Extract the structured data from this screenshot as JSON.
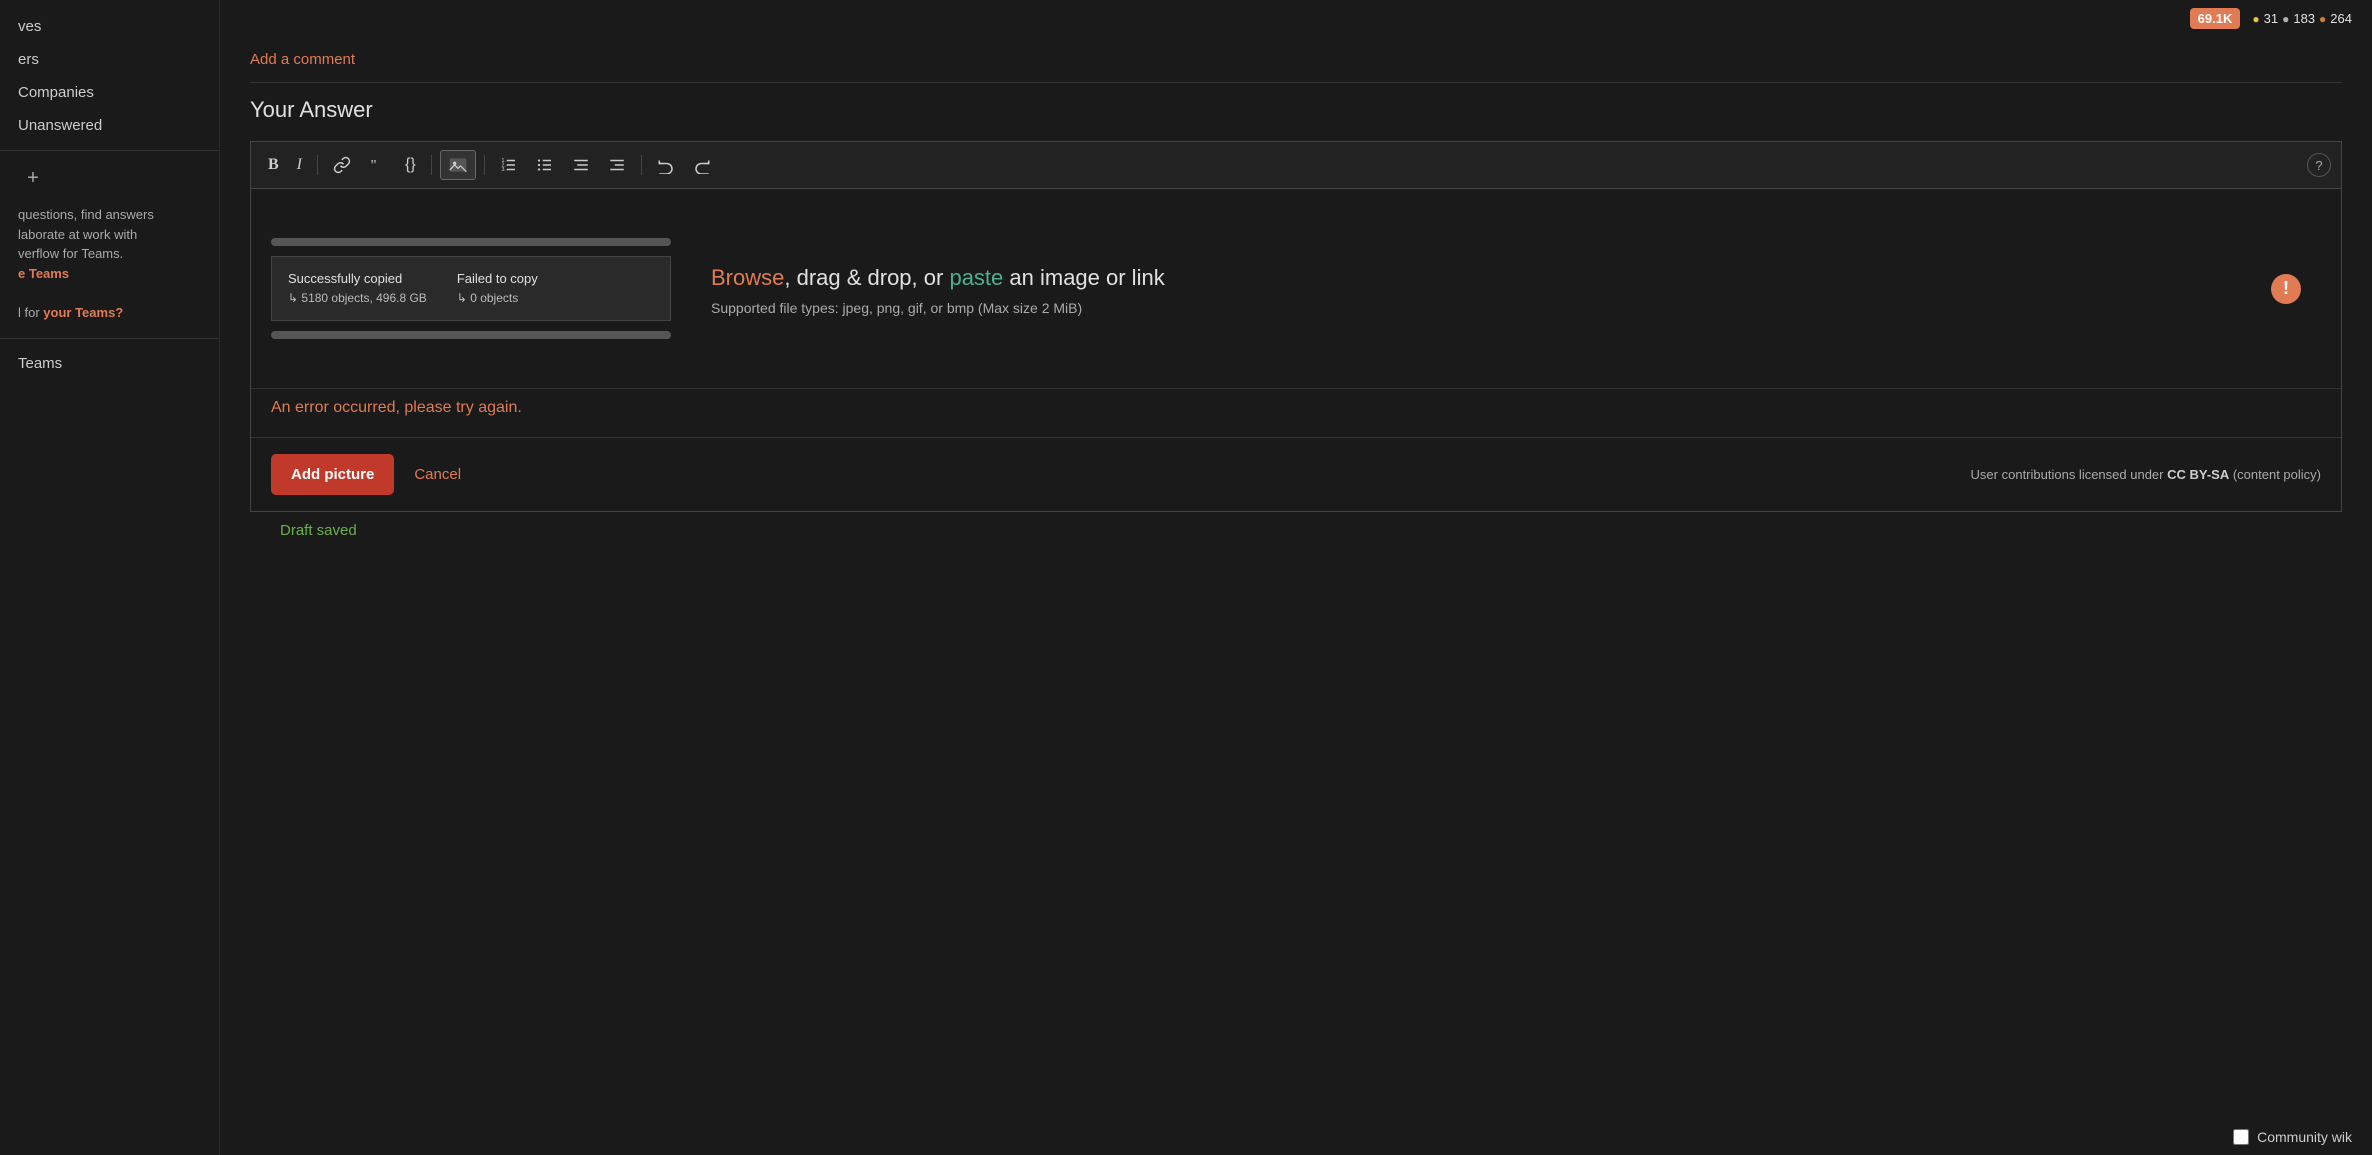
{
  "sidebar": {
    "items": [
      {
        "id": "ves",
        "label": "ves"
      },
      {
        "id": "ers",
        "label": "ers"
      },
      {
        "id": "companies",
        "label": "Companies"
      },
      {
        "id": "unanswered",
        "label": "Unanswered"
      },
      {
        "id": "teams",
        "label": "Teams"
      }
    ],
    "add_button_label": "+",
    "promo_text_1": "questions, find answers",
    "promo_text_2": "laborate at work with",
    "promo_text_3": "verflow for Teams.",
    "promo_link_text": "e Teams",
    "promo_question": "l for ",
    "promo_question_link": "your Teams?"
  },
  "topbar": {
    "user_rep": "69.1K",
    "gold_count": "31",
    "silver_count": "183",
    "bronze_count": "264"
  },
  "comment": {
    "link_text": "Add a comment"
  },
  "answer": {
    "heading": "Your Answer"
  },
  "toolbar": {
    "bold": "B",
    "italic": "I",
    "link": "🔗",
    "blockquote": "❝",
    "code": "{}",
    "image": "🖼",
    "ordered_list": "≡",
    "unordered_list": "≡",
    "indent_left": "≡",
    "indent_right": "≡",
    "undo": "↩",
    "redo": "↪",
    "help": "?"
  },
  "drop_zone": {
    "browse_text": "Browse",
    "middle_text": ", drag & drop, or ",
    "paste_text": "paste",
    "end_text": " an image or link",
    "subtitle": "Supported file types: jpeg, png, gif, or bmp (Max size 2 MiB)",
    "error_text": "An error occurred, please try again.",
    "preview_bar_exists": true,
    "preview_copy_success_label": "Successfully copied",
    "preview_copy_success_value": "↳ 5180 objects, 496.8 GB",
    "preview_copy_fail_label": "Failed to copy",
    "preview_copy_fail_value": "↳ 0 objects"
  },
  "actions": {
    "add_picture_label": "Add picture",
    "cancel_label": "Cancel",
    "license_text": "User contributions licensed under ",
    "license_link_text": "CC BY-SA",
    "license_suffix": " (content policy)"
  },
  "footer": {
    "draft_saved_text": "Draft saved",
    "community_wiki_label": "Community wik"
  }
}
